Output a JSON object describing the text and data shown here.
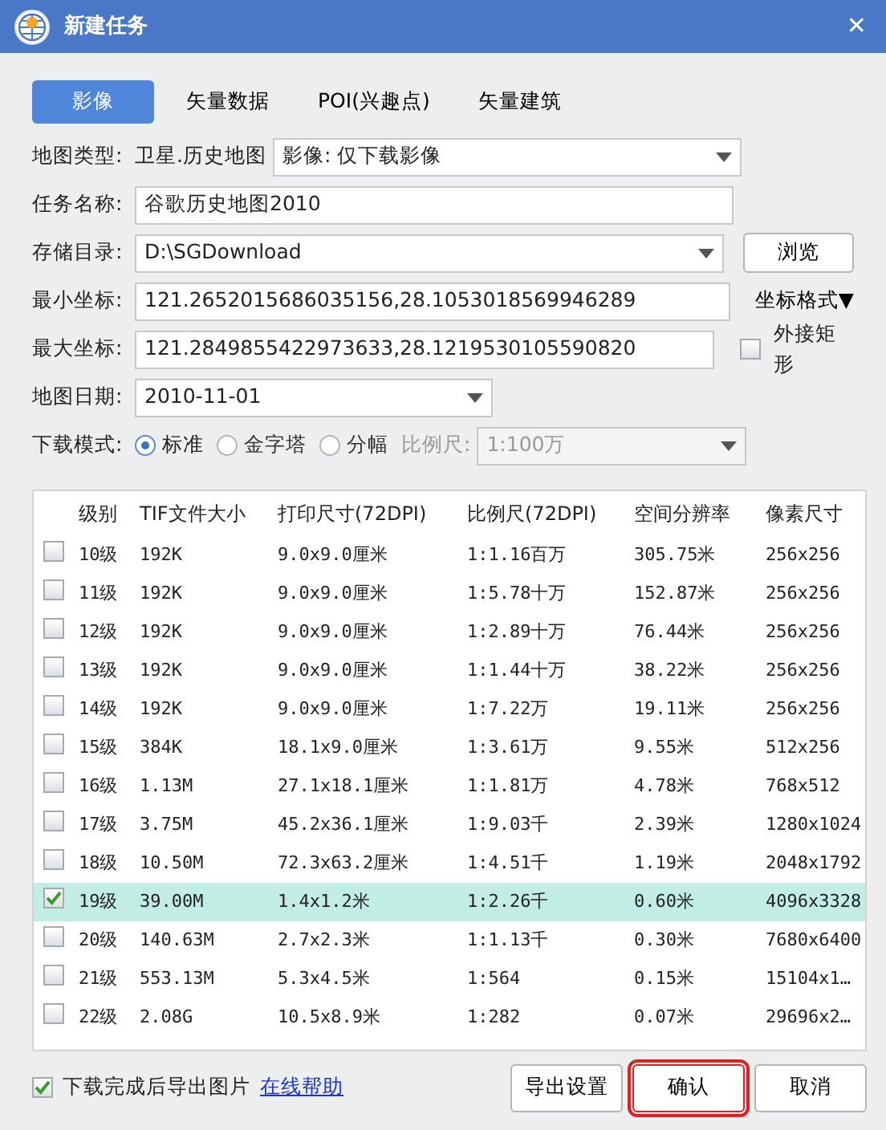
{
  "window": {
    "title": "新建任务",
    "close": "✕"
  },
  "tabs": [
    {
      "label": "影像",
      "selected": true
    },
    {
      "label": "矢量数据",
      "selected": false
    },
    {
      "label": "POI(兴趣点)",
      "selected": false
    },
    {
      "label": "矢量建筑",
      "selected": false
    }
  ],
  "form": {
    "map_type": {
      "label": "地图类型:",
      "value": "卫星.历史地图",
      "select": "影像: 仅下载影像"
    },
    "task_name": {
      "label": "任务名称:",
      "value": "谷歌历史地图2010"
    },
    "save_dir": {
      "label": "存储目录:",
      "value": "D:\\SGDownload",
      "button": "浏览"
    },
    "min_coord": {
      "label": "最小坐标:",
      "value": "121.2652015686035156,28.1053018569946289",
      "button": "坐标格式▼"
    },
    "max_coord": {
      "label": "最大坐标:",
      "value": "121.2849855422973633,28.1219530105590820",
      "checkbox": {
        "label": "外接矩形",
        "checked": false
      }
    },
    "date": {
      "label": "地图日期:",
      "value": "2010-11-01"
    },
    "mode": {
      "label": "下载模式:",
      "options": [
        {
          "label": "标准",
          "selected": true
        },
        {
          "label": "金字塔",
          "selected": false
        },
        {
          "label": "分幅",
          "selected": false
        }
      ],
      "scale_label": "比例尺:",
      "scale_value": "1:100万",
      "disabled": true
    }
  },
  "table": {
    "columns": [
      "级别",
      "TIF文件大小",
      "打印尺寸(72DPI)",
      "比例尺(72DPI)",
      "空间分辨率",
      "像素尺寸"
    ],
    "rows": [
      {
        "cells": [
          "10级",
          "192K",
          "9.0x9.0厘米",
          "1:1.16百万",
          "305.75米",
          "256x256"
        ],
        "checked": false,
        "selected": false
      },
      {
        "cells": [
          "11级",
          "192K",
          "9.0x9.0厘米",
          "1:5.78十万",
          "152.87米",
          "256x256"
        ],
        "checked": false,
        "selected": false
      },
      {
        "cells": [
          "12级",
          "192K",
          "9.0x9.0厘米",
          "1:2.89十万",
          "76.44米",
          "256x256"
        ],
        "checked": false,
        "selected": false
      },
      {
        "cells": [
          "13级",
          "192K",
          "9.0x9.0厘米",
          "1:1.44十万",
          "38.22米",
          "256x256"
        ],
        "checked": false,
        "selected": false
      },
      {
        "cells": [
          "14级",
          "192K",
          "9.0x9.0厘米",
          "1:7.22万",
          "19.11米",
          "256x256"
        ],
        "checked": false,
        "selected": false
      },
      {
        "cells": [
          "15级",
          "384K",
          "18.1x9.0厘米",
          "1:3.61万",
          "9.55米",
          "512x256"
        ],
        "checked": false,
        "selected": false
      },
      {
        "cells": [
          "16级",
          "1.13M",
          "27.1x18.1厘米",
          "1:1.81万",
          "4.78米",
          "768x512"
        ],
        "checked": false,
        "selected": false
      },
      {
        "cells": [
          "17级",
          "3.75M",
          "45.2x36.1厘米",
          "1:9.03千",
          "2.39米",
          "1280x1024"
        ],
        "checked": false,
        "selected": false
      },
      {
        "cells": [
          "18级",
          "10.50M",
          "72.3x63.2厘米",
          "1:4.51千",
          "1.19米",
          "2048x1792"
        ],
        "checked": false,
        "selected": false
      },
      {
        "cells": [
          "19级",
          "39.00M",
          "1.4x1.2米",
          "1:2.26千",
          "0.60米",
          "4096x3328"
        ],
        "checked": true,
        "selected": true
      },
      {
        "cells": [
          "20级",
          "140.63M",
          "2.7x2.3米",
          "1:1.13千",
          "0.30米",
          "7680x6400"
        ],
        "checked": false,
        "selected": false
      },
      {
        "cells": [
          "21级",
          "553.13M",
          "5.3x4.5米",
          "1:564",
          "0.15米",
          "15104x1…"
        ],
        "checked": false,
        "selected": false
      },
      {
        "cells": [
          "22级",
          "2.08G",
          "10.5x8.9米",
          "1:282",
          "0.07米",
          "29696x2…"
        ],
        "checked": false,
        "selected": false
      }
    ]
  },
  "footer": {
    "export": {
      "label": "下载完成后导出图片",
      "checked": true
    },
    "help_link": "在线帮助",
    "buttons": [
      {
        "label": "导出设置",
        "highlighted": false
      },
      {
        "label": "确认",
        "highlighted": true
      },
      {
        "label": "取消",
        "highlighted": false
      }
    ]
  }
}
